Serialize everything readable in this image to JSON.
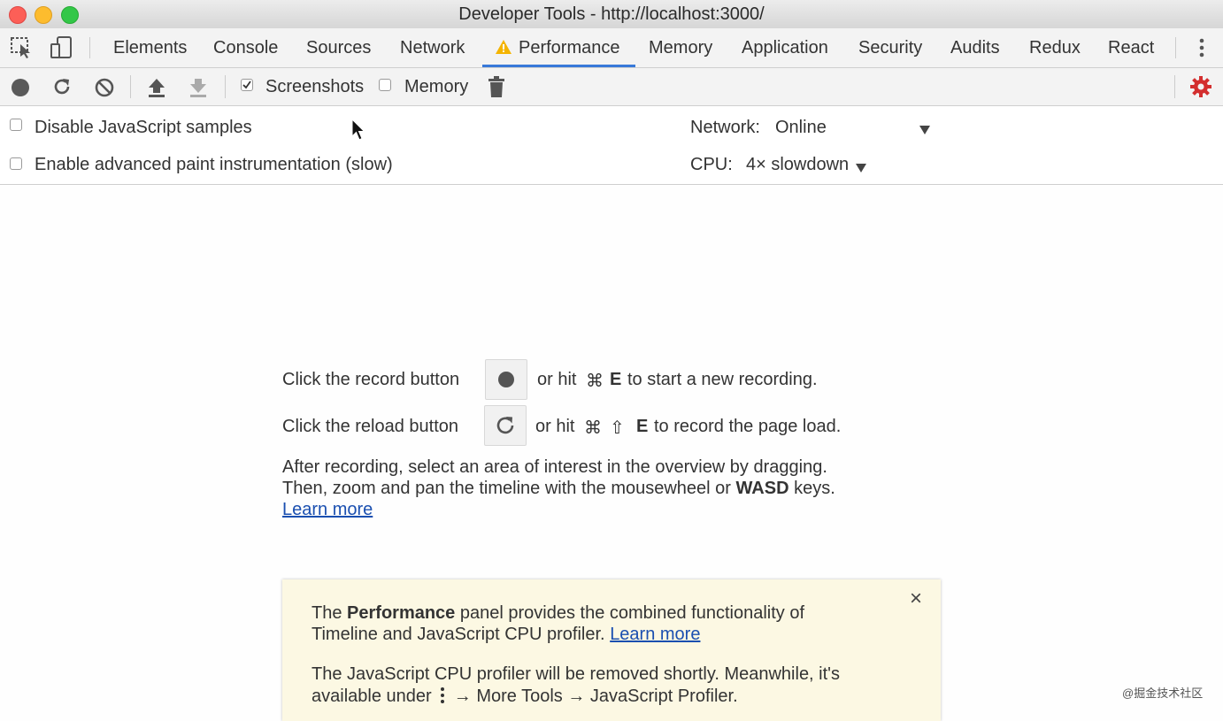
{
  "window": {
    "title": "Developer Tools - http://localhost:3000/"
  },
  "tabs": [
    {
      "label": "Elements"
    },
    {
      "label": "Console"
    },
    {
      "label": "Sources"
    },
    {
      "label": "Network"
    },
    {
      "label": "Performance",
      "active": true,
      "warning": true
    },
    {
      "label": "Memory"
    },
    {
      "label": "Application"
    },
    {
      "label": "Security"
    },
    {
      "label": "Audits"
    },
    {
      "label": "Redux"
    },
    {
      "label": "React"
    }
  ],
  "toolbar": {
    "screenshots_label": "Screenshots",
    "screenshots_checked": true,
    "memory_label": "Memory",
    "memory_checked": false
  },
  "settings": {
    "disable_js_label": "Disable JavaScript samples",
    "advanced_paint_label": "Enable advanced paint instrumentation (slow)",
    "network_label": "Network:",
    "network_value": "Online",
    "cpu_label": "CPU:",
    "cpu_value": "4× slowdown"
  },
  "landing": {
    "record_prefix": "Click the record button",
    "record_suffix_a": "or hit",
    "record_key_cmd": "⌘",
    "record_key": "E",
    "record_suffix_b": "to start a new recording.",
    "reload_prefix": "Click the reload button",
    "reload_suffix_a": "or hit",
    "reload_key_cmd": "⌘",
    "reload_key_shift": "⇧",
    "reload_key": "E",
    "reload_suffix_b": "to record the page load.",
    "hint_line1": "After recording, select an area of interest in the overview by dragging.",
    "hint_line2_a": "Then, zoom and pan the timeline with the mousewheel or",
    "hint_line2_bold": "WASD",
    "hint_line2_b": "keys.",
    "learn_more": "Learn more"
  },
  "notice": {
    "p1_a": "The",
    "p1_bold": "Performance",
    "p1_b": "panel provides the combined functionality of",
    "p1_line2": "Timeline and JavaScript CPU profiler.",
    "p1_link": "Learn more",
    "p2_line1": "The JavaScript CPU profiler will be removed shortly. Meanwhile, it's",
    "p2_line2_a": "available under",
    "p2_line2_b": "→ More Tools → JavaScript Profiler.",
    "close": "×"
  },
  "watermark": "@掘金技术社区",
  "colors": {
    "accent": "#3879d9",
    "settings_gear": "#d32f2f",
    "notice_bg": "#fcf8e3",
    "warning": "#f4b400"
  }
}
